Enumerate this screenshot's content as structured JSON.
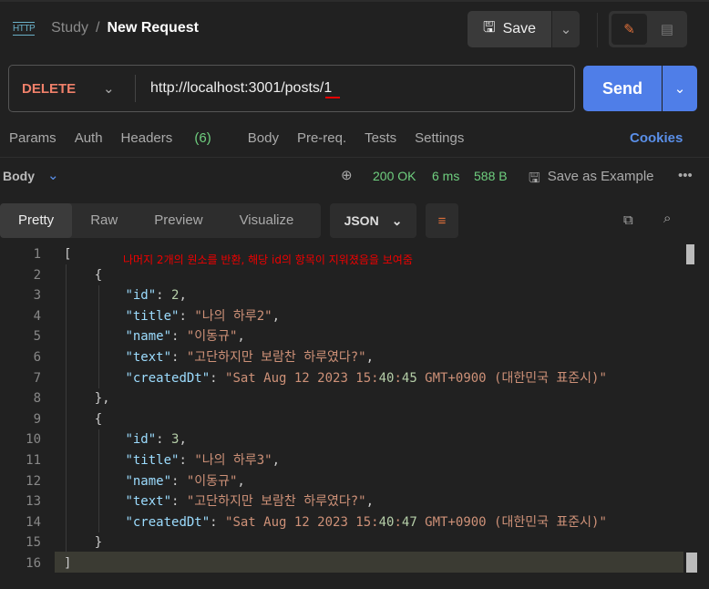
{
  "header": {
    "icon": "http-icon",
    "collection": "Study",
    "separator": "/",
    "request_name": "New Request",
    "save_label": "Save"
  },
  "request": {
    "method": "DELETE",
    "url": "http://localhost:3001/posts/1",
    "send_label": "Send"
  },
  "tabs": {
    "params": "Params",
    "auth": "Auth",
    "headers": "Headers",
    "headers_count": "(6)",
    "body": "Body",
    "prereq": "Pre-req.",
    "tests": "Tests",
    "settings": "Settings",
    "cookies": "Cookies"
  },
  "response": {
    "body_label": "Body",
    "status": "200 OK",
    "time": "6 ms",
    "size": "588 B",
    "save_example": "Save as Example",
    "view_tabs": [
      "Pretty",
      "Raw",
      "Preview",
      "Visualize"
    ],
    "active_view": "Pretty",
    "format": "JSON"
  },
  "annotation": "나머지 2개의 원소를 반환, 해당 id의 항목이 지워졌음을 보여줌",
  "code_lines": [
    {
      "n": "1",
      "t": "["
    },
    {
      "n": "2",
      "t": "    {"
    },
    {
      "n": "3",
      "t": "        \"id\": 2,"
    },
    {
      "n": "4",
      "t": "        \"title\": \"나의 하루2\","
    },
    {
      "n": "5",
      "t": "        \"name\": \"이동규\","
    },
    {
      "n": "6",
      "t": "        \"text\": \"고단하지만 보람찬 하루였다?\","
    },
    {
      "n": "7",
      "t": "        \"createdDt\": \"Sat Aug 12 2023 15:40:45 GMT+0900 (대한민국 표준시)\""
    },
    {
      "n": "8",
      "t": "    },"
    },
    {
      "n": "9",
      "t": "    {"
    },
    {
      "n": "10",
      "t": "        \"id\": 3,"
    },
    {
      "n": "11",
      "t": "        \"title\": \"나의 하루3\","
    },
    {
      "n": "12",
      "t": "        \"name\": \"이동규\","
    },
    {
      "n": "13",
      "t": "        \"text\": \"고단하지만 보람찬 하루였다?\","
    },
    {
      "n": "14",
      "t": "        \"createdDt\": \"Sat Aug 12 2023 15:40:47 GMT+0900 (대한민국 표준시)\""
    },
    {
      "n": "15",
      "t": "    }"
    },
    {
      "n": "16",
      "t": "]"
    }
  ],
  "colors": {
    "accent": "#4f7ee8",
    "method": "#f0806a",
    "success": "#6fcf7f",
    "annotation": "#ee0000"
  }
}
